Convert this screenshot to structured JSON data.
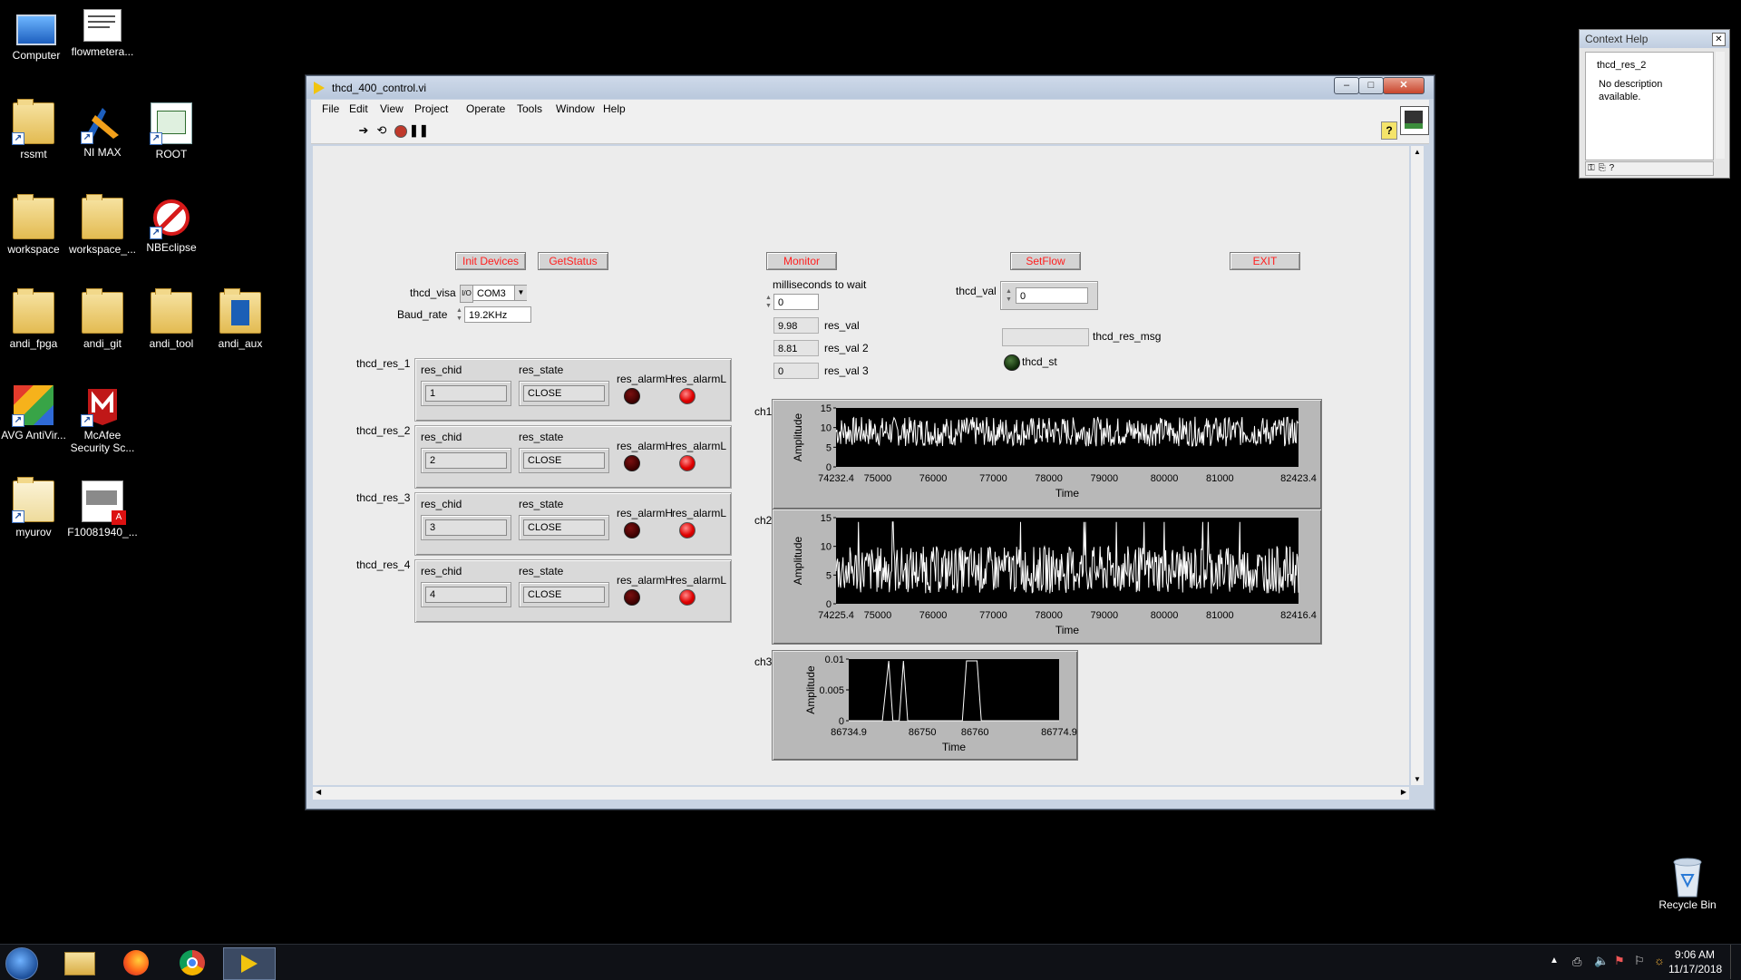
{
  "desktop": {
    "icons": [
      {
        "label": "Computer"
      },
      {
        "label": "flowmetera..."
      },
      {
        "label": "rssmt"
      },
      {
        "label": "NI MAX"
      },
      {
        "label": "ROOT"
      },
      {
        "label": "workspace"
      },
      {
        "label": "workspace_..."
      },
      {
        "label": "NBEclipse"
      },
      {
        "label": "andi_fpga"
      },
      {
        "label": "andi_git"
      },
      {
        "label": "andi_tool"
      },
      {
        "label": "andi_aux"
      },
      {
        "label": "AVG AntiVir..."
      },
      {
        "label": "McAfee Security Sc..."
      },
      {
        "label": "myurov"
      },
      {
        "label": "F10081940_..."
      }
    ],
    "recycle_bin": "Recycle Bin"
  },
  "window": {
    "title": "thcd_400_control.vi",
    "menu": [
      "File",
      "Edit",
      "View",
      "Project",
      "Operate",
      "Tools",
      "Window",
      "Help"
    ],
    "toolbar_icons": [
      "run-arrow-icon",
      "run-continuously-icon",
      "abort-icon",
      "pause-icon"
    ],
    "buttons": {
      "init_devices": "Init Devices",
      "get_status": "GetStatus",
      "monitor": "Monitor",
      "set_flow": "SetFlow",
      "exit": "EXIT"
    },
    "visa": {
      "label": "thcd_visa",
      "value": "COM3"
    },
    "baud": {
      "label": "Baud_rate",
      "value": "19.2KHz"
    },
    "wait": {
      "label": "milliseconds to wait",
      "value": "0"
    },
    "res_vals": [
      {
        "label": "res_val",
        "value": "9.98"
      },
      {
        "label": "res_val 2",
        "value": "8.81"
      },
      {
        "label": "res_val 3",
        "value": "0"
      }
    ],
    "thcd_val": {
      "label": "thcd_val",
      "value": "0"
    },
    "thcd_res_msg": {
      "label": "thcd_res_msg",
      "value": ""
    },
    "thcd_st": {
      "label": "thcd_st"
    },
    "resources": [
      {
        "label": "thcd_res_1",
        "chid_label": "res_chid",
        "state_label": "res_state",
        "alarmH_label": "res_alarmH",
        "alarmL_label": "res_alarmL",
        "chid": "1",
        "state": "CLOSE"
      },
      {
        "label": "thcd_res_2",
        "chid_label": "res_chid",
        "state_label": "res_state",
        "alarmH_label": "res_alarmH",
        "alarmL_label": "res_alarmL",
        "chid": "2",
        "state": "CLOSE"
      },
      {
        "label": "thcd_res_3",
        "chid_label": "res_chid",
        "state_label": "res_state",
        "alarmH_label": "res_alarmH",
        "alarmL_label": "res_alarmL",
        "chid": "3",
        "state": "CLOSE"
      },
      {
        "label": "thcd_res_4",
        "chid_label": "res_chid",
        "state_label": "res_state",
        "alarmH_label": "res_alarmH",
        "alarmL_label": "res_alarmL",
        "chid": "4",
        "state": "CLOSE"
      }
    ],
    "graphs": [
      {
        "name": "ch1",
        "ylabel": "Amplitude",
        "xlabel": "Time",
        "yticks": [
          "15",
          "10",
          "5",
          "0"
        ],
        "xticks": [
          "74232.4",
          "75000",
          "76000",
          "77000",
          "78000",
          "79000",
          "80000",
          "81000",
          "82423.4"
        ]
      },
      {
        "name": "ch2",
        "ylabel": "Amplitude",
        "xlabel": "Time",
        "yticks": [
          "15",
          "10",
          "5",
          "0"
        ],
        "xticks": [
          "74225.4",
          "75000",
          "76000",
          "77000",
          "78000",
          "79000",
          "80000",
          "81000",
          "82416.4"
        ]
      },
      {
        "name": "ch3",
        "ylabel": "Amplitude",
        "xlabel": "Time",
        "yticks": [
          "0.01",
          "0.005",
          "0"
        ],
        "xticks": [
          "86734.9",
          "86750",
          "86760",
          "86774.9"
        ]
      }
    ]
  },
  "context_help": {
    "title": "Context Help",
    "item": "thcd_res_2",
    "description": "No description available."
  },
  "taskbar": {
    "time": "9:06 AM",
    "date": "11/17/2018"
  },
  "colors": {
    "plot_bg": "#000000",
    "plot_line": "#ffffff",
    "button_text": "#ff2020",
    "led_red": "#e00000"
  }
}
